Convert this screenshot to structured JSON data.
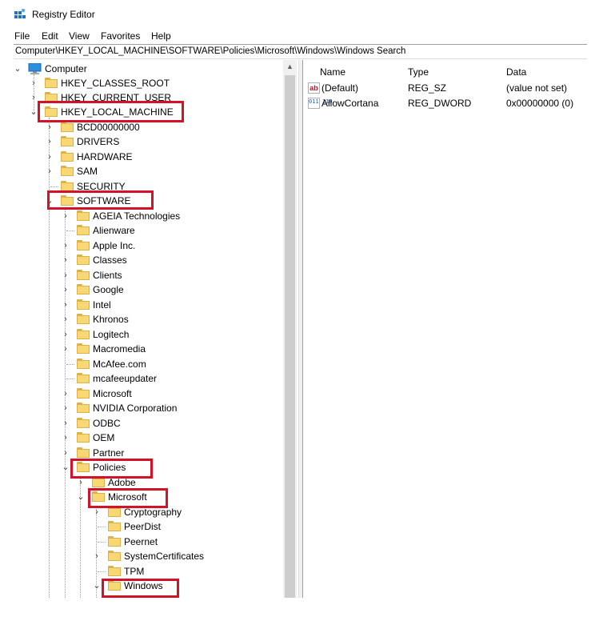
{
  "window": {
    "title": "Registry Editor",
    "icon": "registry-editor-icon"
  },
  "menu": [
    "File",
    "Edit",
    "View",
    "Favorites",
    "Help"
  ],
  "address": "Computer\\HKEY_LOCAL_MACHINE\\SOFTWARE\\Policies\\Microsoft\\Windows\\Windows Search",
  "tree": {
    "root_label": "Computer",
    "hives": [
      "HKEY_CLASSES_ROOT",
      "HKEY_CURRENT_USER",
      "HKEY_LOCAL_MACHINE"
    ],
    "hklm_children": [
      "BCD00000000",
      "DRIVERS",
      "HARDWARE",
      "SAM",
      "SECURITY",
      "SOFTWARE"
    ],
    "software_children": [
      "AGEIA Technologies",
      "Alienware",
      "Apple Inc.",
      "Classes",
      "Clients",
      "Google",
      "Intel",
      "Khronos",
      "Logitech",
      "Macromedia",
      "McAfee.com",
      "mcafeeupdater",
      "Microsoft",
      "NVIDIA Corporation",
      "ODBC",
      "OEM",
      "Partner",
      "Policies"
    ],
    "policies_children": [
      "Adobe",
      "Microsoft"
    ],
    "ms_policy_children": [
      "Cryptography",
      "PeerDist",
      "Peernet",
      "SystemCertificates",
      "TPM",
      "Windows"
    ]
  },
  "values": {
    "headers": [
      "Name",
      "Type",
      "Data"
    ],
    "rows": [
      {
        "icon": "string-value-icon",
        "glyph": "ab",
        "name": "(Default)",
        "type": "REG_SZ",
        "data": "(value not set)"
      },
      {
        "icon": "binary-value-icon",
        "glyph": "011 110",
        "name": "AllowCortana",
        "type": "REG_DWORD",
        "data": "0x00000000 (0)"
      }
    ]
  },
  "colors": {
    "highlight": "#d3122a",
    "folder": "#f8d775",
    "folder_edge": "#dcb14a"
  }
}
